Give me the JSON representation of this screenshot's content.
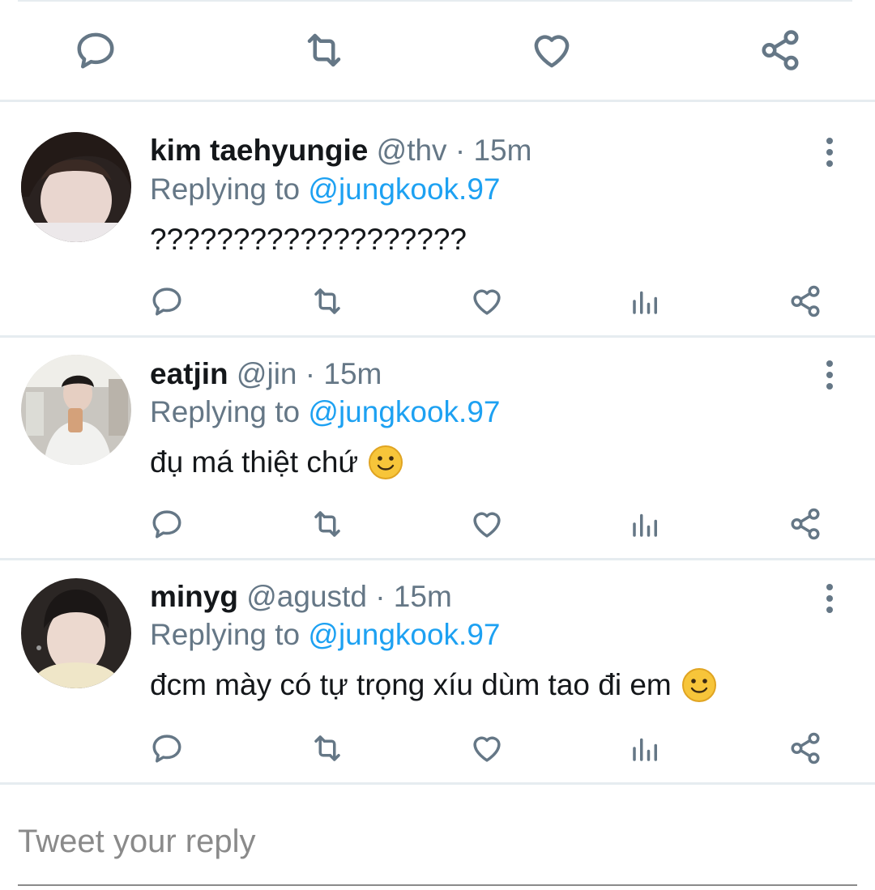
{
  "tweet_actions": [
    "reply-icon",
    "retweet-icon",
    "like-icon",
    "share-icon"
  ],
  "colors": {
    "accent": "#1da1f2",
    "secondary_text": "#657786",
    "divider": "#e6ecf0"
  },
  "replies": [
    {
      "name": "kim taehyungie",
      "handle": "@thv",
      "separator": "·",
      "time": "15m",
      "replying_prefix": "Replying to",
      "replying_to": "@jungkook.97",
      "text": "???????????????????",
      "emoji": ""
    },
    {
      "name": "eatjin",
      "handle": "@jin",
      "separator": "·",
      "time": "15m",
      "replying_prefix": "Replying to",
      "replying_to": "@jungkook.97",
      "text": "đụ má thiệt chứ",
      "emoji": "slightly-smiling-face"
    },
    {
      "name": "minyg",
      "handle": "@agustd",
      "separator": "·",
      "time": "15m",
      "replying_prefix": "Replying to",
      "replying_to": "@jungkook.97",
      "text": "đcm mày có tự trọng xíu dùm tao đi em",
      "emoji": "slightly-smiling-face"
    }
  ],
  "compose": {
    "placeholder": "Tweet your reply"
  }
}
